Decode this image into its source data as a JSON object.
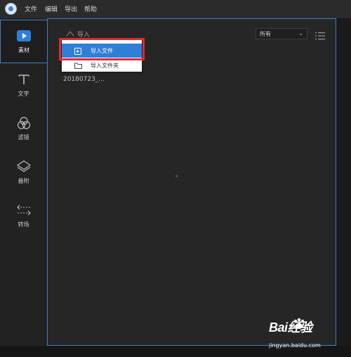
{
  "menubar": {
    "items": [
      "文件",
      "编辑",
      "导出",
      "帮助"
    ]
  },
  "sidebar": {
    "items": [
      {
        "label": "素材",
        "icon": "media-icon",
        "active": true
      },
      {
        "label": "文字",
        "icon": "text-icon",
        "active": false
      },
      {
        "label": "滤镜",
        "icon": "filter-icon",
        "active": false
      },
      {
        "label": "叠附",
        "icon": "overlay-icon",
        "active": false
      },
      {
        "label": "转场",
        "icon": "transition-icon",
        "active": false
      }
    ]
  },
  "main": {
    "import_label": "导入",
    "filter_value": "所有",
    "file_name": "20180723_..."
  },
  "dropdown": {
    "items": [
      "导入文件",
      "导入文件夹"
    ]
  },
  "watermark": {
    "brand": "Bai经验",
    "url": "jingyan.baidu.com"
  },
  "colors": {
    "accent": "#2f7fd8",
    "highlight": "#e8262f",
    "panel_border": "#3a7fc9"
  }
}
